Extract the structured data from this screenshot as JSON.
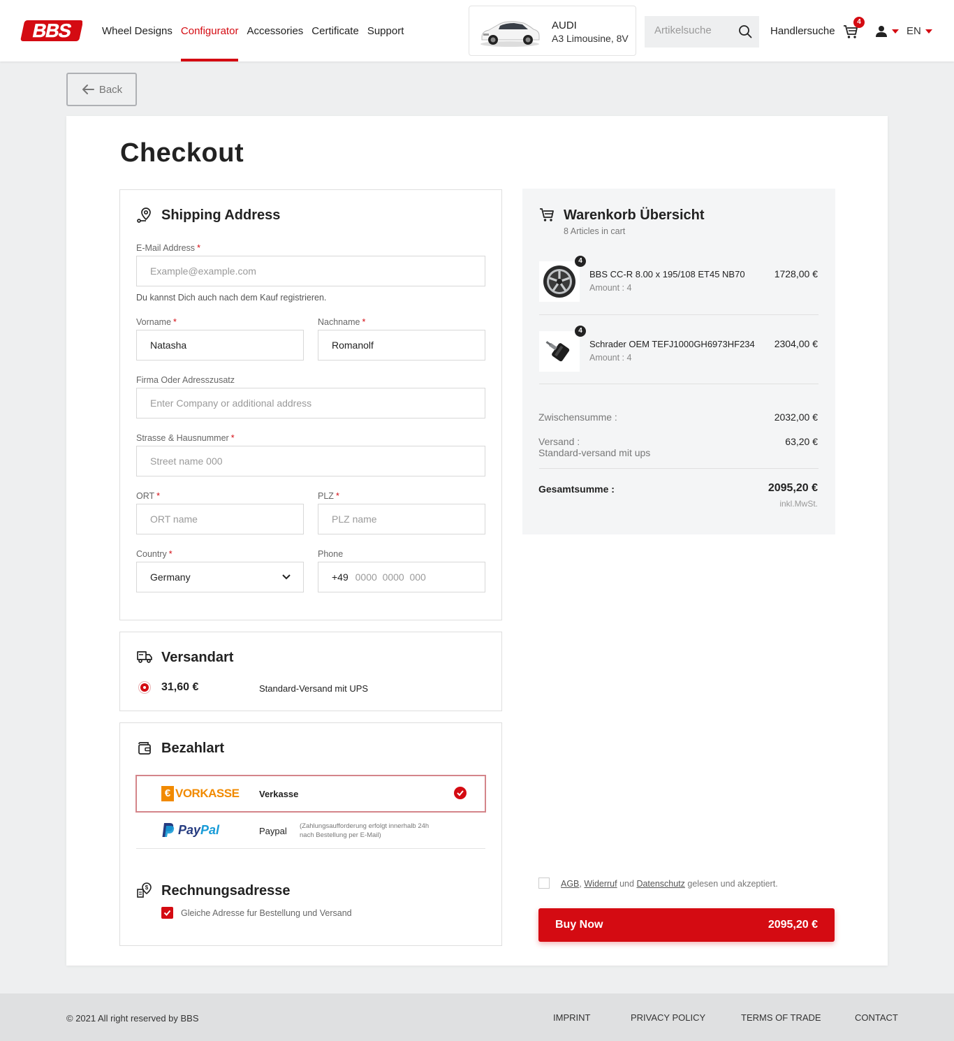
{
  "header": {
    "logo_text": "BBS",
    "nav": [
      "Wheel Designs",
      "Configurator",
      "Accessories",
      "Certificate",
      "Support"
    ],
    "active_nav": "Configurator",
    "car": {
      "make": "AUDI",
      "model": "A3 Limousine, 8V"
    },
    "search_placeholder": "Artikelsuche",
    "dealer_label": "Handlersuche",
    "cart_count": "4",
    "language": "EN"
  },
  "back_label": "Back",
  "page_title": "Checkout",
  "shipping": {
    "title": "Shipping Address",
    "email_label": "E-Mail Address",
    "email_placeholder": "Example@example.com",
    "register_hint": "Du kannst Dich auch nach dem Kauf registrieren.",
    "firstname_label": "Vorname",
    "firstname_value": "Natasha",
    "lastname_label": "Nachname",
    "lastname_value": "Romanolf",
    "company_label": "Firma Oder Adresszusatz",
    "company_placeholder": "Enter Company or additional address",
    "street_label": "Strasse & Hausnummer",
    "street_placeholder": "Street name 000",
    "city_label": "ORT",
    "city_placeholder": "ORT name",
    "zip_label": "PLZ",
    "zip_placeholder": "PLZ name",
    "country_label": "Country",
    "country_value": "Germany",
    "phone_label": "Phone",
    "phone_prefix": "+49",
    "phone_placeholder": "0000  0000  000"
  },
  "shipping_method": {
    "title": "Versandart",
    "price": "31,60 €",
    "name": "Standard-Versand mit UPS"
  },
  "payment": {
    "title": "Bezahlart",
    "options": [
      {
        "logo": "VORKASSE",
        "label": "Verkasse",
        "note": "",
        "selected": true
      },
      {
        "logo": "PayPal",
        "label": "Paypal",
        "note_line1": "(Zahlungsaufforderung erfolgt innerhalb 24h",
        "note_line2": "nach Bestellung per E-Mail)",
        "selected": false
      }
    ]
  },
  "billing": {
    "title": "Rechnungsadresse",
    "same_address_label": "Gleiche Adresse fur Bestellung und Versand",
    "same_address_checked": true
  },
  "cart_summary": {
    "title": "Warenkorb Übersicht",
    "subtitle": "8 Articles in cart",
    "items": [
      {
        "name": "BBS CC-R 8.00 x 195/108 ET45 NB70",
        "amount": "Amount : 4",
        "price": "1728,00 €",
        "qty": "4",
        "icon": "wheel-icon"
      },
      {
        "name": "Schrader OEM TEFJ1000GH6973HF234",
        "amount": "Amount : 4",
        "price": "2304,00 €",
        "qty": "4",
        "icon": "tpms-sensor-icon"
      }
    ],
    "subtotal_label": "Zwischensumme :",
    "subtotal_value": "2032,00 €",
    "shipping_label": "Versand :",
    "shipping_sub": "Standard-versand mit ups",
    "shipping_value": "63,20 €",
    "total_label": "Gesamtsumme :",
    "total_value": "2095,20 €",
    "tax_note": "inkl.MwSt."
  },
  "terms": {
    "agb": "AGB",
    "sep1": ",",
    "widerruf": "Widerruf",
    "und": "und",
    "datenschutz": "Datenschutz",
    "rest": "gelesen und akzeptiert."
  },
  "buy": {
    "label": "Buy Now",
    "amount": "2095,20 €"
  },
  "footer": {
    "copyright": "© 2021 All right reserved by BBS",
    "links": [
      "IMPRINT",
      "PRIVACY POLICY",
      "TERMS OF TRADE",
      "CONTACT"
    ]
  },
  "colors": {
    "accent": "#d40b12",
    "background": "#eeeff0",
    "summary_bg": "#f4f5f6"
  }
}
